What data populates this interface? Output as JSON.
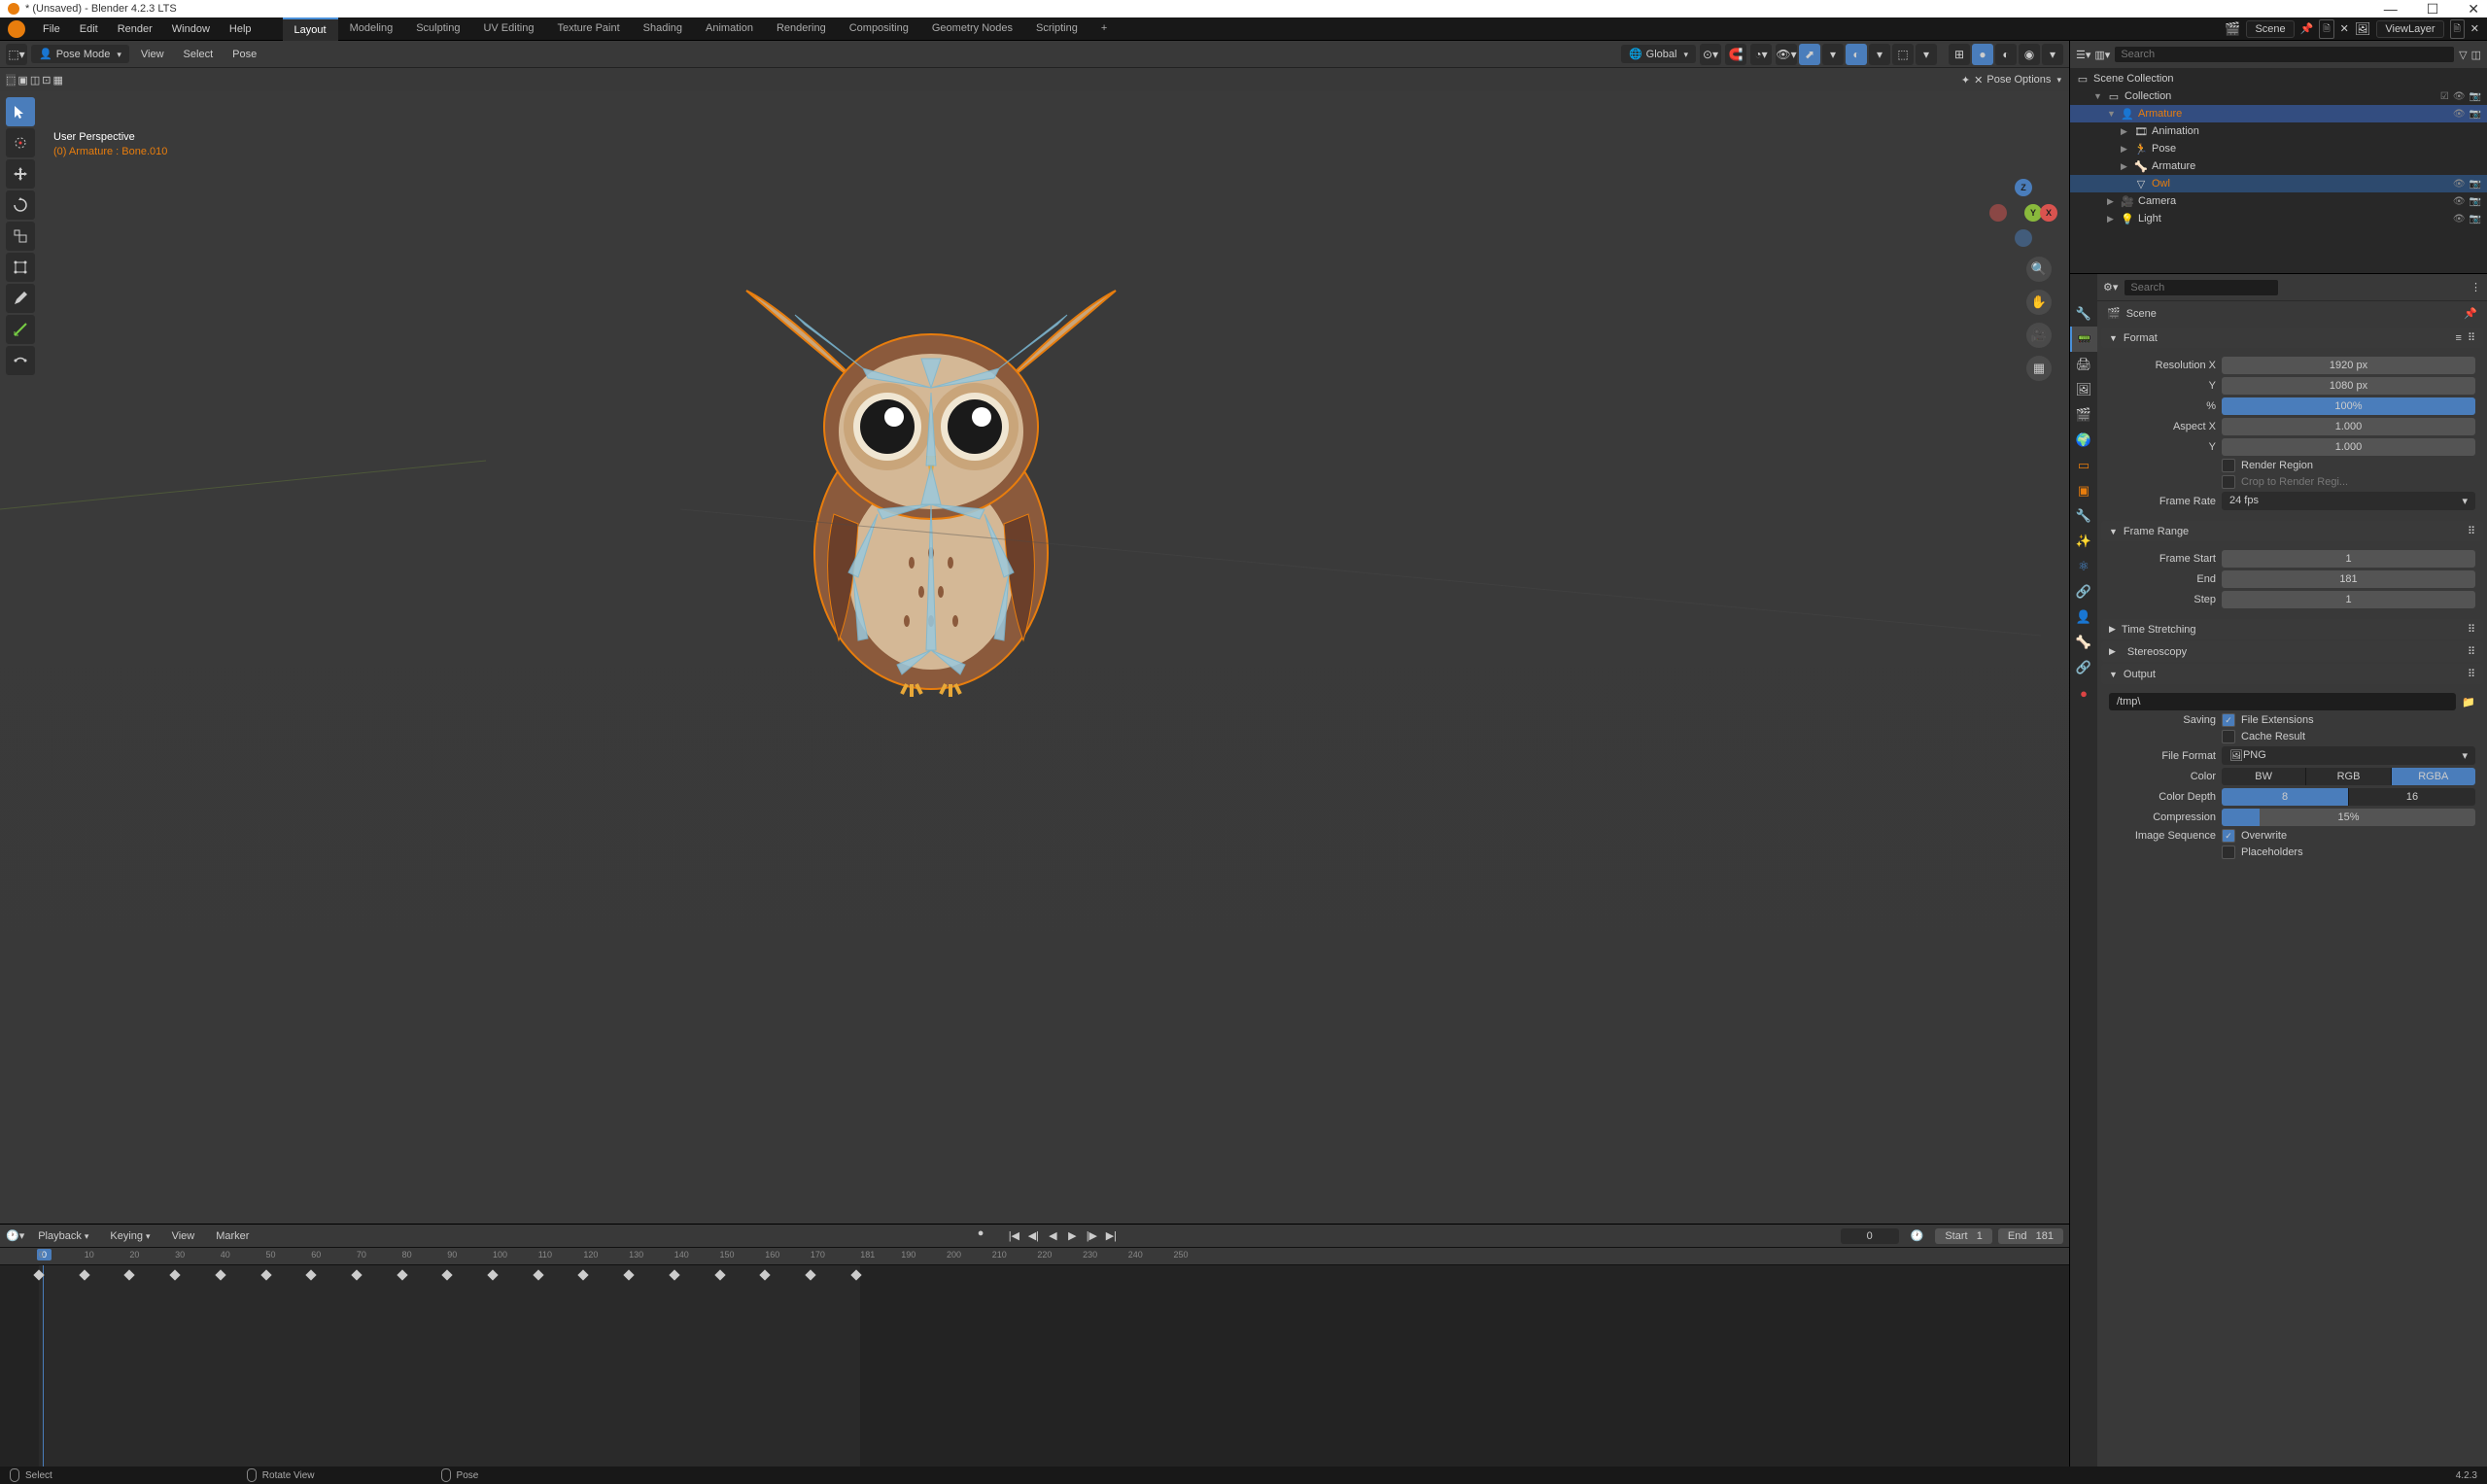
{
  "titlebar": {
    "title": "* (Unsaved) - Blender 4.2.3 LTS"
  },
  "menubar": {
    "items": [
      "File",
      "Edit",
      "Render",
      "Window",
      "Help"
    ],
    "workspaces": [
      "Layout",
      "Modeling",
      "Sculpting",
      "UV Editing",
      "Texture Paint",
      "Shading",
      "Animation",
      "Rendering",
      "Compositing",
      "Geometry Nodes",
      "Scripting"
    ],
    "active_workspace": "Layout",
    "scene_label": "Scene",
    "viewlayer_label": "ViewLayer"
  },
  "viewport": {
    "mode": "Pose Mode",
    "header_menus": [
      "View",
      "Select",
      "Pose"
    ],
    "orientation": "Global",
    "info_line1": "User Perspective",
    "info_line2": "(0) Armature : Bone.010",
    "pose_options": "Pose Options"
  },
  "outliner": {
    "search_placeholder": "Search",
    "root": "Scene Collection",
    "items": [
      {
        "label": "Collection",
        "depth": 1,
        "icon": "collection",
        "expanded": true
      },
      {
        "label": "Armature",
        "depth": 2,
        "icon": "armature",
        "expanded": true,
        "selected": true,
        "orange": true
      },
      {
        "label": "Animation",
        "depth": 3,
        "icon": "anim"
      },
      {
        "label": "Pose",
        "depth": 3,
        "icon": "pose"
      },
      {
        "label": "Armature",
        "depth": 3,
        "icon": "armature-data"
      },
      {
        "label": "Owl",
        "depth": 3,
        "icon": "mesh",
        "highlighted": true,
        "orange": true
      },
      {
        "label": "Camera",
        "depth": 2,
        "icon": "camera"
      },
      {
        "label": "Light",
        "depth": 2,
        "icon": "light"
      }
    ]
  },
  "properties": {
    "search_placeholder": "Search",
    "breadcrumb": "Scene",
    "format": {
      "title": "Format",
      "res_x_label": "Resolution X",
      "res_x": "1920 px",
      "res_y_label": "Y",
      "res_y": "1080 px",
      "pct_label": "%",
      "pct": "100%",
      "aspect_x_label": "Aspect X",
      "aspect_x": "1.000",
      "aspect_y_label": "Y",
      "aspect_y": "1.000",
      "render_region": "Render Region",
      "crop_region": "Crop to Render Regi...",
      "frame_rate_label": "Frame Rate",
      "frame_rate": "24 fps"
    },
    "frame_range": {
      "title": "Frame Range",
      "start_label": "Frame Start",
      "start": "1",
      "end_label": "End",
      "end": "181",
      "step_label": "Step",
      "step": "1"
    },
    "time_stretching": {
      "title": "Time Stretching"
    },
    "stereoscopy": {
      "title": "Stereoscopy"
    },
    "output": {
      "title": "Output",
      "path": "/tmp\\",
      "saving_label": "Saving",
      "file_ext": "File Extensions",
      "cache_result": "Cache Result",
      "file_format_label": "File Format",
      "file_format": "PNG",
      "color_label": "Color",
      "color_modes": [
        "BW",
        "RGB",
        "RGBA"
      ],
      "color_active": "RGBA",
      "depth_label": "Color Depth",
      "depths": [
        "8",
        "16"
      ],
      "depth_active": "8",
      "compression_label": "Compression",
      "compression": "15%",
      "img_seq_label": "Image Sequence",
      "overwrite": "Overwrite",
      "placeholders": "Placeholders"
    }
  },
  "timeline": {
    "menus_left": [
      "Playback",
      "Keying",
      "View",
      "Marker"
    ],
    "current_frame": "0",
    "start_label": "Start",
    "start": "1",
    "end_label": "End",
    "end": "181",
    "ticks": [
      0,
      10,
      20,
      30,
      40,
      50,
      60,
      70,
      80,
      90,
      100,
      110,
      120,
      130,
      140,
      150,
      160,
      170,
      181,
      190,
      200,
      210,
      220,
      230,
      240,
      250
    ],
    "keyframes": [
      0,
      10,
      20,
      30,
      40,
      50,
      60,
      70,
      80,
      90,
      100,
      110,
      120,
      130,
      140,
      150,
      160,
      170,
      180
    ]
  },
  "statusbar": {
    "select": "Select",
    "rotate": "Rotate View",
    "pose": "Pose",
    "version": "4.2.3"
  }
}
